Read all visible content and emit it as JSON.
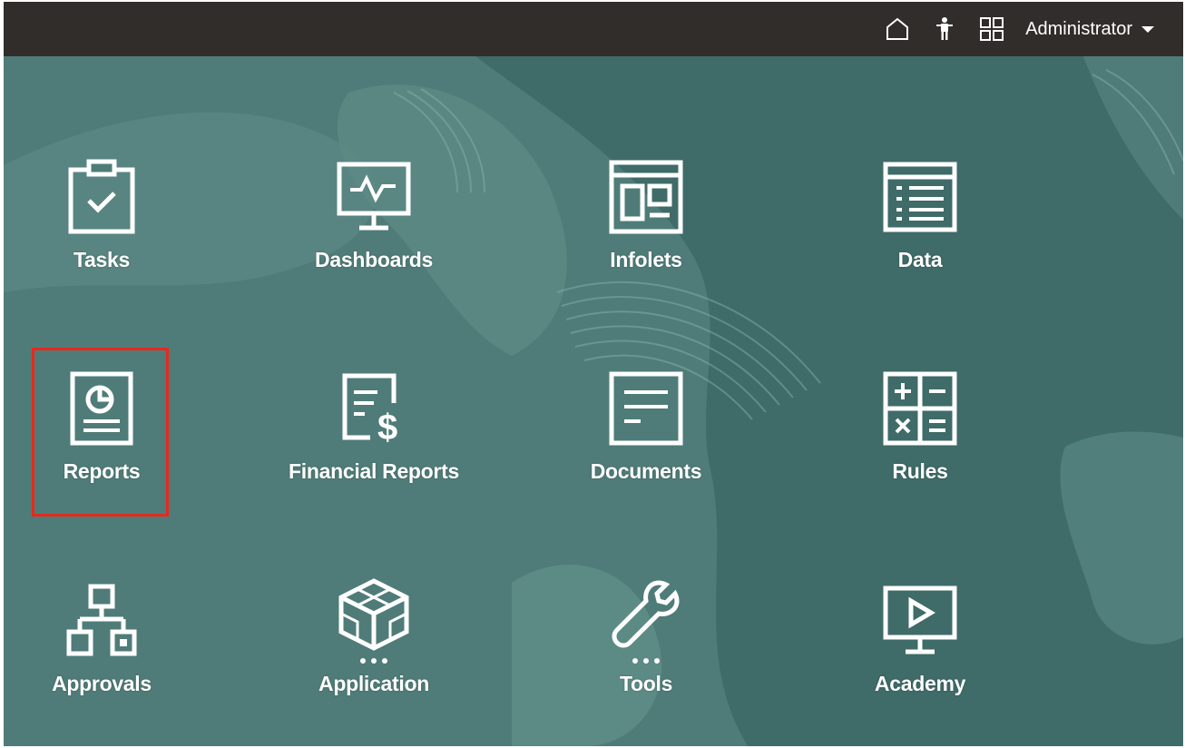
{
  "header": {
    "icons": [
      "home-icon",
      "accessibility-icon",
      "navigator-grid-icon"
    ],
    "user_label": "Administrator"
  },
  "colors": {
    "header_bg": "#312d2a",
    "main_bg": "#4f7c78",
    "highlight": "#e8281e",
    "icon_stroke": "#ffffff"
  },
  "tiles": [
    {
      "label": "Tasks",
      "icon": "clipboard-check-icon"
    },
    {
      "label": "Dashboards",
      "icon": "monitor-pulse-icon"
    },
    {
      "label": "Infolets",
      "icon": "infolet-layout-icon"
    },
    {
      "label": "Data",
      "icon": "data-form-icon"
    },
    {
      "label": "Reports",
      "icon": "report-pie-icon",
      "highlighted": true
    },
    {
      "label": "Financial Reports",
      "icon": "financial-report-icon"
    },
    {
      "label": "Documents",
      "icon": "document-icon"
    },
    {
      "label": "Rules",
      "icon": "calculator-rules-icon"
    },
    {
      "label": "Approvals",
      "icon": "hierarchy-icon"
    },
    {
      "label": "Application",
      "icon": "cube-icon",
      "has_more": true
    },
    {
      "label": "Tools",
      "icon": "wrench-icon",
      "has_more": true
    },
    {
      "label": "Academy",
      "icon": "video-play-icon"
    }
  ]
}
